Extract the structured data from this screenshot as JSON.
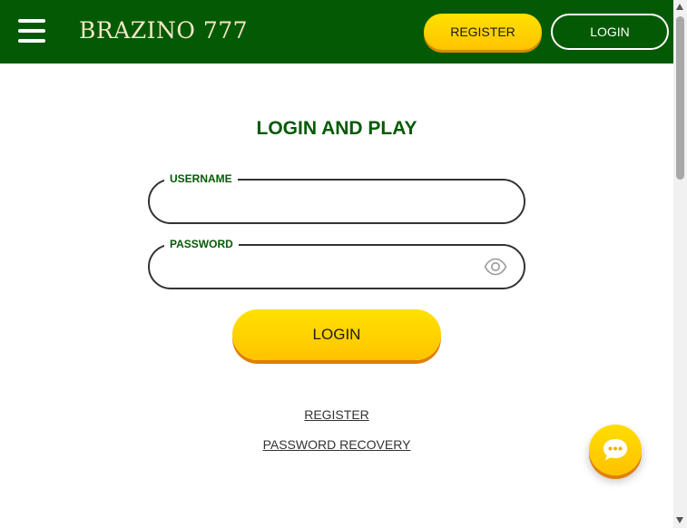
{
  "header": {
    "logo_text": "BRAZINO 777",
    "register_label": "REGISTER",
    "login_label": "LOGIN",
    "menu_icon": "hamburger-menu-icon"
  },
  "main": {
    "title": "LOGIN AND PLAY",
    "username": {
      "label": "USERNAME",
      "value": ""
    },
    "password": {
      "label": "PASSWORD",
      "value": "",
      "toggle_icon": "eye-icon"
    },
    "login_button": "LOGIN",
    "register_link": "REGISTER",
    "recovery_link": "PASSWORD RECOVERY"
  },
  "chat": {
    "icon": "chat-bubble-icon"
  },
  "colors": {
    "header_bg": "#045A04",
    "accent_yellow": "#FFD000",
    "title_green": "#045A04"
  }
}
